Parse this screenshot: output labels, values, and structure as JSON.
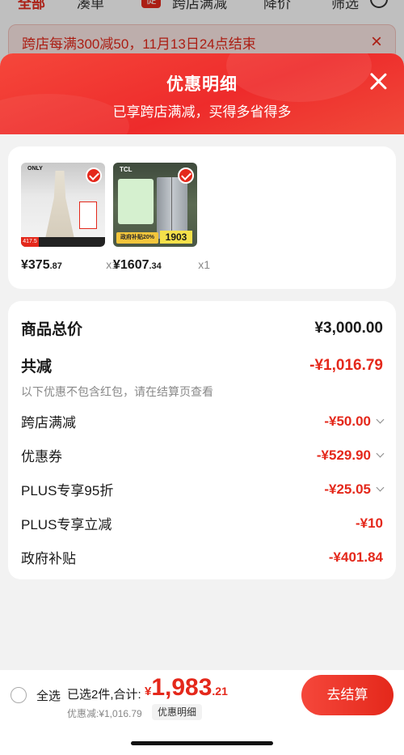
{
  "background": {
    "tabs": [
      "全部",
      "凑单",
      "跨店满减",
      "降价",
      "筛选"
    ],
    "badge": "促",
    "notice": "跨店每满300减50，11月13日24点结束"
  },
  "sheet": {
    "title": "优惠明细",
    "subtitle": "已享跨店满减，买得多省得多"
  },
  "products": [
    {
      "brand": "ONLY",
      "price_int": "¥375",
      "price_dec": ".87",
      "qty": "x1",
      "tag": "417.5"
    },
    {
      "brand": "TCL",
      "price_int": "¥1607",
      "price_dec": ".34",
      "qty": "x1",
      "promo": "政府补贴20%",
      "big_price": "1903"
    }
  ],
  "summary": {
    "total_label": "商品总价",
    "total_value": "¥3,000.00",
    "reduce_label": "共减",
    "reduce_value": "-¥1,016.79",
    "note": "以下优惠不包含红包，请在结算页查看",
    "items": [
      {
        "label": "跨店满减",
        "value": "-¥50.00"
      },
      {
        "label": "优惠券",
        "value": "-¥529.90"
      },
      {
        "label": "PLUS专享95折",
        "value": "-¥25.05"
      },
      {
        "label": "PLUS专享立减",
        "value": "-¥10"
      },
      {
        "label": "政府补贴",
        "value": "-¥401.84"
      }
    ]
  },
  "bottom_bar": {
    "select_all": "全选",
    "selected": "已选2件,合计:",
    "currency": "¥",
    "total_int": "1,983",
    "total_dec": ".21",
    "saved": "优惠减:¥1,016.79",
    "detail_link": "优惠明细",
    "checkout": "去结算"
  },
  "colors": {
    "accent": "#e4281b",
    "background": "#f2f2f2"
  }
}
